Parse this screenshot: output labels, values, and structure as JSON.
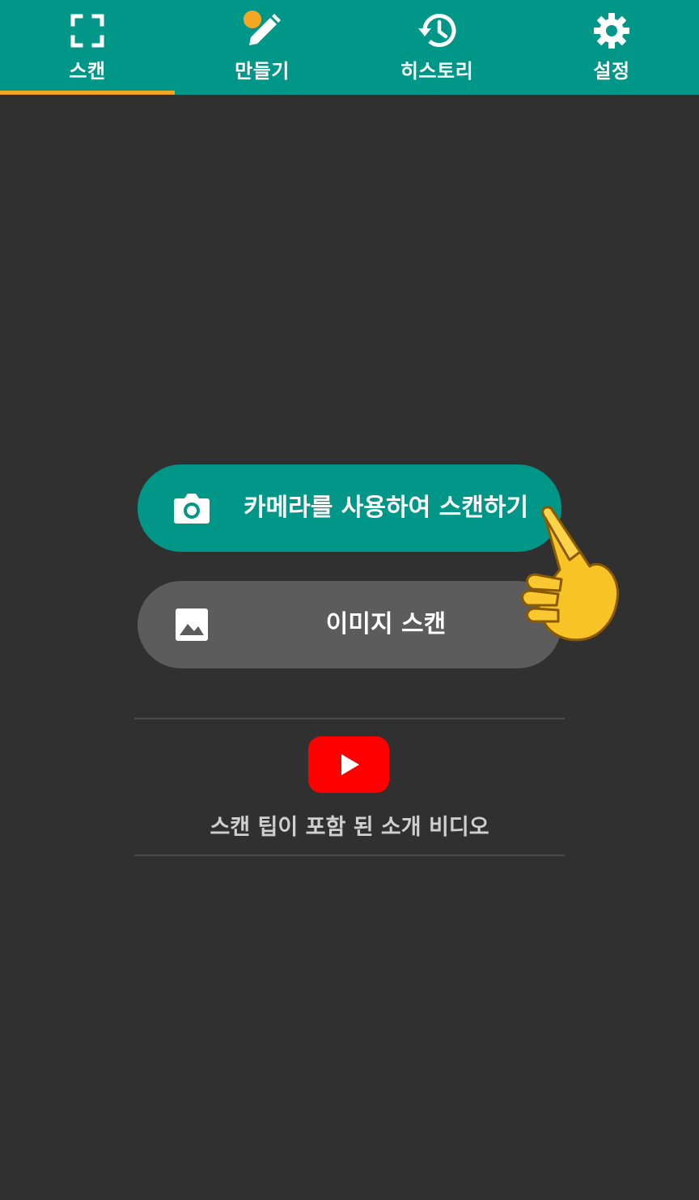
{
  "tabs": [
    {
      "label": "스캔",
      "icon": "scan-frame-icon",
      "selected": true
    },
    {
      "label": "만들기",
      "icon": "pencil-create-icon",
      "selected": false
    },
    {
      "label": "히스토리",
      "icon": "history-icon",
      "selected": false
    },
    {
      "label": "설정",
      "icon": "gear-icon",
      "selected": false
    }
  ],
  "actions": {
    "camera_scan_label": "카메라를 사용하여 스캔하기",
    "camera_scan_icon": "camera-icon",
    "image_scan_label": "이미지 스캔",
    "image_scan_icon": "image-icon"
  },
  "video": {
    "label": "스캔 팁이 포함 된 소개 비디오",
    "icon": "youtube-play-icon"
  },
  "colors": {
    "primary": "#009688",
    "accent": "#f5a623",
    "background": "#303030",
    "secondary_button": "#5c5c5c",
    "youtube_red": "#ff0000"
  }
}
